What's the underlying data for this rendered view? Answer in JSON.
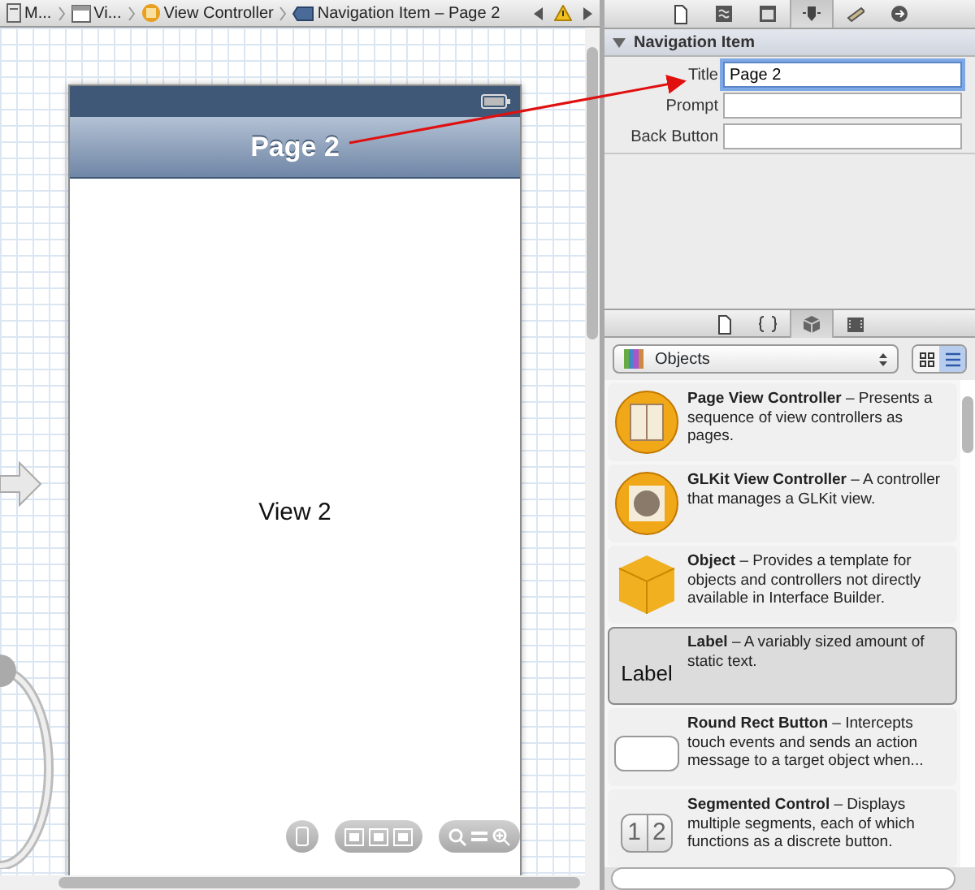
{
  "breadcrumbs": [
    {
      "kind": "file",
      "label": "M..."
    },
    {
      "kind": "window",
      "label": "Vi..."
    },
    {
      "kind": "controller",
      "label": "View Controller"
    },
    {
      "kind": "navitem",
      "label": "Navigation Item – Page 2"
    }
  ],
  "canvas": {
    "nav_title": "Page 2",
    "view_label": "View 2"
  },
  "inspector": {
    "tabs": [
      {
        "kind": "file",
        "selected": false
      },
      {
        "kind": "help",
        "selected": false
      },
      {
        "kind": "identity",
        "selected": false
      },
      {
        "kind": "attributes",
        "selected": true
      },
      {
        "kind": "size",
        "selected": false
      },
      {
        "kind": "connections",
        "selected": false
      }
    ],
    "section": {
      "title": "Navigation Item",
      "expanded": true
    },
    "fields": [
      {
        "label": "Title",
        "value": "Page 2",
        "focused": true
      },
      {
        "label": "Prompt",
        "focused": false
      },
      {
        "label": "Back Button",
        "focused": false
      }
    ]
  },
  "library": {
    "tabs": [
      {
        "kind": "file",
        "selected": false
      },
      {
        "kind": "code",
        "selected": false
      },
      {
        "kind": "object",
        "selected": true
      },
      {
        "kind": "media",
        "selected": false
      }
    ],
    "filter": "Objects",
    "view_buttons": [
      {
        "kind": "grid",
        "selected": false
      },
      {
        "kind": "list",
        "selected": true
      }
    ],
    "items": [
      {
        "kind": "page",
        "text": "**Page View Controller** – Presents a sequence of view controllers as pages.",
        "selected": false
      },
      {
        "kind": "glkit",
        "text": "**GLKit View Controller** – A controller that manages a GLKit view.",
        "selected": false
      },
      {
        "kind": "object",
        "text": "**Object** – Provides a template for objects and controllers not directly available in Interface Builder.",
        "selected": false
      },
      {
        "kind": "label",
        "icon_text": "Label",
        "text": "**Label** – A variably sized amount of static text.",
        "selected": true
      },
      {
        "kind": "button",
        "text": "**Round Rect Button** – Intercepts touch events and sends an action message to a target object when...",
        "selected": false
      },
      {
        "kind": "segmented",
        "icon_text": [
          "1",
          "2"
        ],
        "text": "**Segmented Control** – Displays multiple segments, each of which functions as a discrete button.",
        "selected": false
      }
    ]
  }
}
